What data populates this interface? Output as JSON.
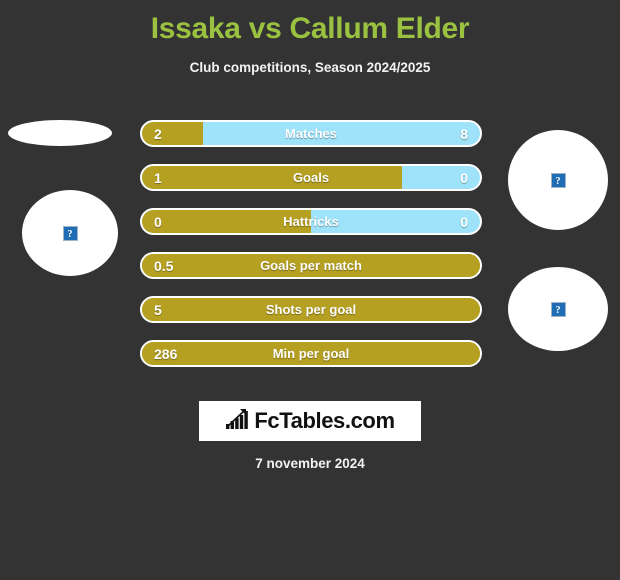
{
  "header": {
    "title": "Issaka vs Callum Elder",
    "subtitle": "Club competitions, Season 2024/2025",
    "title_color": "#9bc140"
  },
  "placeholders": {
    "icon_glyph": "?",
    "left_flag": "broken-image-icon",
    "left_player": "broken-image-icon",
    "right_player": "broken-image-icon",
    "right_flag": "broken-image-icon"
  },
  "footer": {
    "logo_text": "FcTables.com",
    "logo_icon": "bar-chart-arrow-icon",
    "date": "7 november 2024"
  },
  "chart_data": {
    "type": "bar",
    "title": "Issaka vs Callum Elder",
    "subtitle": "Club competitions, Season 2024/2025",
    "xlabel": "",
    "ylabel": "",
    "grid": false,
    "legend_position": "none",
    "orientation": "horizontal-diverging",
    "colors": {
      "left_series": "#b6a022",
      "right_series": "#9ee3fa",
      "background": "#333333"
    },
    "series": [
      {
        "name": "Issaka",
        "values": [
          2,
          1,
          0,
          0.5,
          5,
          286
        ]
      },
      {
        "name": "Callum Elder",
        "values": [
          8,
          0,
          0,
          null,
          null,
          null
        ]
      }
    ],
    "categories": [
      "Matches",
      "Goals",
      "Hattricks",
      "Goals per match",
      "Shots per goal",
      "Min per goal"
    ],
    "rows": [
      {
        "label": "Matches",
        "left": "2",
        "right": "8",
        "left_pct": 18,
        "has_right": true
      },
      {
        "label": "Goals",
        "left": "1",
        "right": "0",
        "left_pct": 77,
        "has_right": true
      },
      {
        "label": "Hattricks",
        "left": "0",
        "right": "0",
        "left_pct": 50,
        "has_right": true
      },
      {
        "label": "Goals per match",
        "left": "0.5",
        "right": "",
        "left_pct": 100,
        "has_right": false
      },
      {
        "label": "Shots per goal",
        "left": "5",
        "right": "",
        "left_pct": 100,
        "has_right": false
      },
      {
        "label": "Min per goal",
        "left": "286",
        "right": "",
        "left_pct": 100,
        "has_right": false
      }
    ]
  }
}
